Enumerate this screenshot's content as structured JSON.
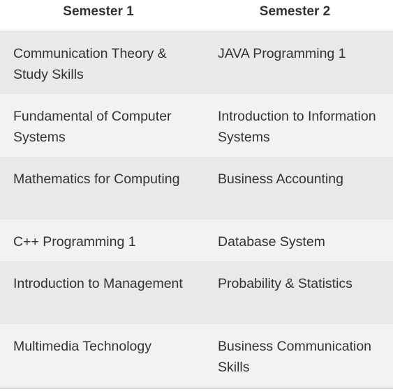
{
  "headers": {
    "semester1": "Semester 1",
    "semester2": "Semester 2"
  },
  "rows": [
    {
      "semester1": "Communication Theory & Study Skills",
      "semester2": "JAVA Programming 1"
    },
    {
      "semester1": "Fundamental of Computer Systems",
      "semester2": "Introduction to Information Systems"
    },
    {
      "semester1": "Mathematics for Computing",
      "semester2": "Business Accounting"
    },
    {
      "semester1": "C++ Programming 1",
      "semester2": "Database System"
    },
    {
      "semester1": "Introduction to Management",
      "semester2": "Probability & Statistics"
    },
    {
      "semester1": "Multimedia Technology",
      "semester2": "Business Communication Skills"
    }
  ]
}
